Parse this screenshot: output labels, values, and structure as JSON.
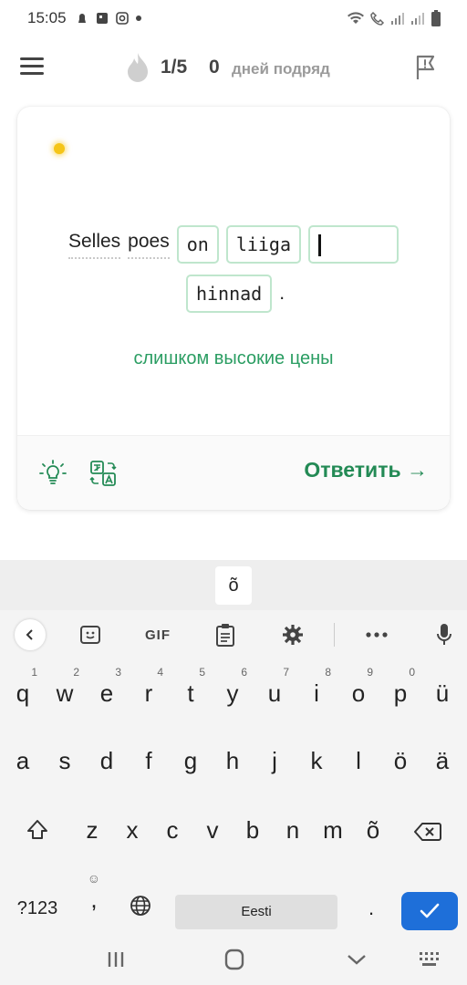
{
  "status_bar": {
    "time": "15:05"
  },
  "header": {
    "progress": "1/5",
    "streak_count": "0",
    "streak_label": "дней подряд"
  },
  "exercise": {
    "sentence_row1": [
      "Selles",
      "poes"
    ],
    "chips_row1": [
      "on",
      "liiga"
    ],
    "input_value": "",
    "chips_row2": [
      "hinnad"
    ],
    "period": ".",
    "translation": "слишком высокие цены"
  },
  "card_footer": {
    "answer_label": "Ответить →"
  },
  "keyboard": {
    "suggestion": "õ",
    "gif_label": "GIF",
    "rows": [
      [
        {
          "k": "q",
          "h": "1"
        },
        {
          "k": "w",
          "h": "2"
        },
        {
          "k": "e",
          "h": "3"
        },
        {
          "k": "r",
          "h": "4"
        },
        {
          "k": "t",
          "h": "5"
        },
        {
          "k": "y",
          "h": "6"
        },
        {
          "k": "u",
          "h": "7"
        },
        {
          "k": "i",
          "h": "8"
        },
        {
          "k": "o",
          "h": "9"
        },
        {
          "k": "p",
          "h": "0"
        },
        {
          "k": "ü",
          "h": ""
        }
      ],
      [
        {
          "k": "a",
          "h": ""
        },
        {
          "k": "s",
          "h": ""
        },
        {
          "k": "d",
          "h": ""
        },
        {
          "k": "f",
          "h": ""
        },
        {
          "k": "g",
          "h": ""
        },
        {
          "k": "h",
          "h": ""
        },
        {
          "k": "j",
          "h": ""
        },
        {
          "k": "k",
          "h": ""
        },
        {
          "k": "l",
          "h": ""
        },
        {
          "k": "ö",
          "h": ""
        },
        {
          "k": "ä",
          "h": ""
        }
      ],
      [
        {
          "k": "z",
          "h": ""
        },
        {
          "k": "x",
          "h": ""
        },
        {
          "k": "c",
          "h": ""
        },
        {
          "k": "v",
          "h": ""
        },
        {
          "k": "b",
          "h": ""
        },
        {
          "k": "n",
          "h": ""
        },
        {
          "k": "m",
          "h": ""
        },
        {
          "k": "õ",
          "h": ""
        }
      ]
    ],
    "symbols_key": "?123",
    "comma_key": ",",
    "period_key": ".",
    "space_label": "Eesti",
    "emoji_hint": "☺"
  }
}
